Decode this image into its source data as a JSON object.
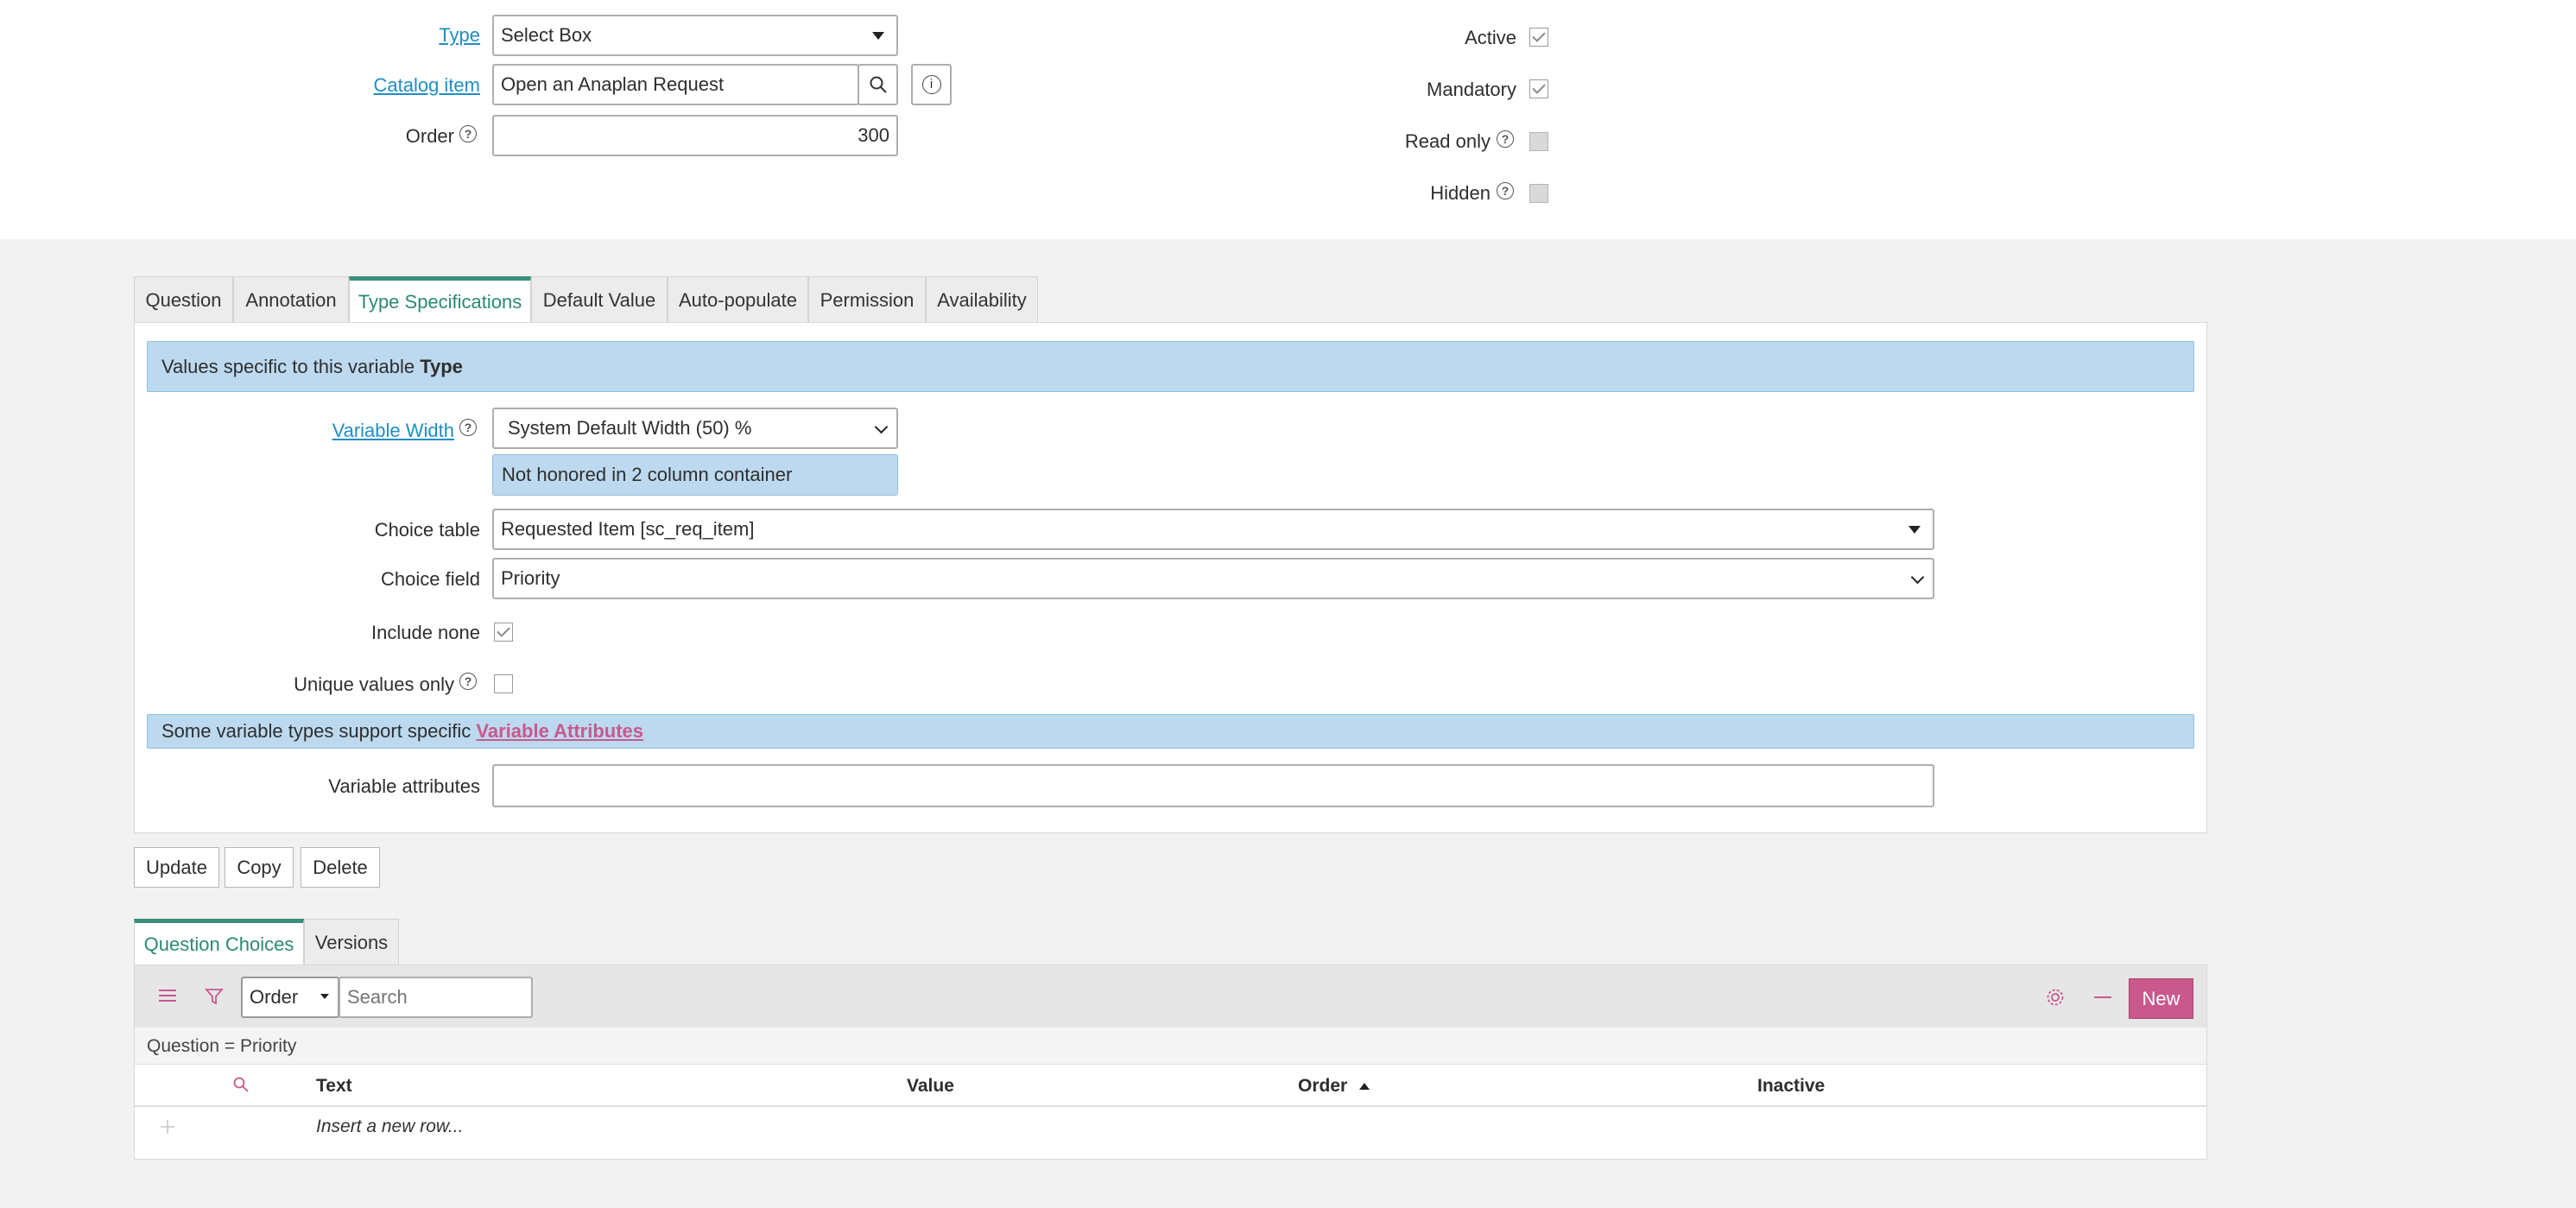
{
  "form": {
    "type_label": "Type",
    "type_value": "Select Box",
    "catalog_item_label": "Catalog item",
    "catalog_item_value": "Open an Anaplan Request",
    "order_label": "Order",
    "order_value": "300",
    "active_label": "Active",
    "mandatory_label": "Mandatory",
    "readonly_label": "Read only",
    "hidden_label": "Hidden",
    "help_glyph": "?",
    "info_glyph": "i"
  },
  "tabs": [
    "Question",
    "Annotation",
    "Type Specifications",
    "Default Value",
    "Auto-populate",
    "Permission",
    "Availability"
  ],
  "type_spec": {
    "banner_prefix": "Values specific to this variable",
    "banner_bold": "Type",
    "variable_width_label": "Variable Width",
    "variable_width_value": "System Default Width (50) %",
    "width_note": "Not honored in 2 column container",
    "choice_table_label": "Choice table",
    "choice_table_value": "Requested Item [sc_req_item]",
    "choice_field_label": "Choice field",
    "choice_field_value": "Priority",
    "include_none_label": "Include none",
    "unique_values_label": "Unique values only",
    "attr_banner_prefix": "Some variable types support specific",
    "attr_banner_link": "Variable Attributes",
    "variable_attributes_label": "Variable attributes",
    "variable_attributes_value": ""
  },
  "actions": {
    "update": "Update",
    "copy": "Copy",
    "delete": "Delete"
  },
  "related_tabs": [
    "Question Choices",
    "Versions"
  ],
  "list": {
    "sort_field": "Order",
    "search_placeholder": "Search",
    "new_label": "New",
    "filter_text": "Question = Priority",
    "columns": [
      "Text",
      "Value",
      "Order",
      "Inactive"
    ],
    "insert_row": "Insert a new row..."
  },
  "colors": {
    "accent": "#2b8a73",
    "link": "#1f8ec4",
    "new_button": "#c9588d",
    "info_bar": "#bcd9ef"
  }
}
